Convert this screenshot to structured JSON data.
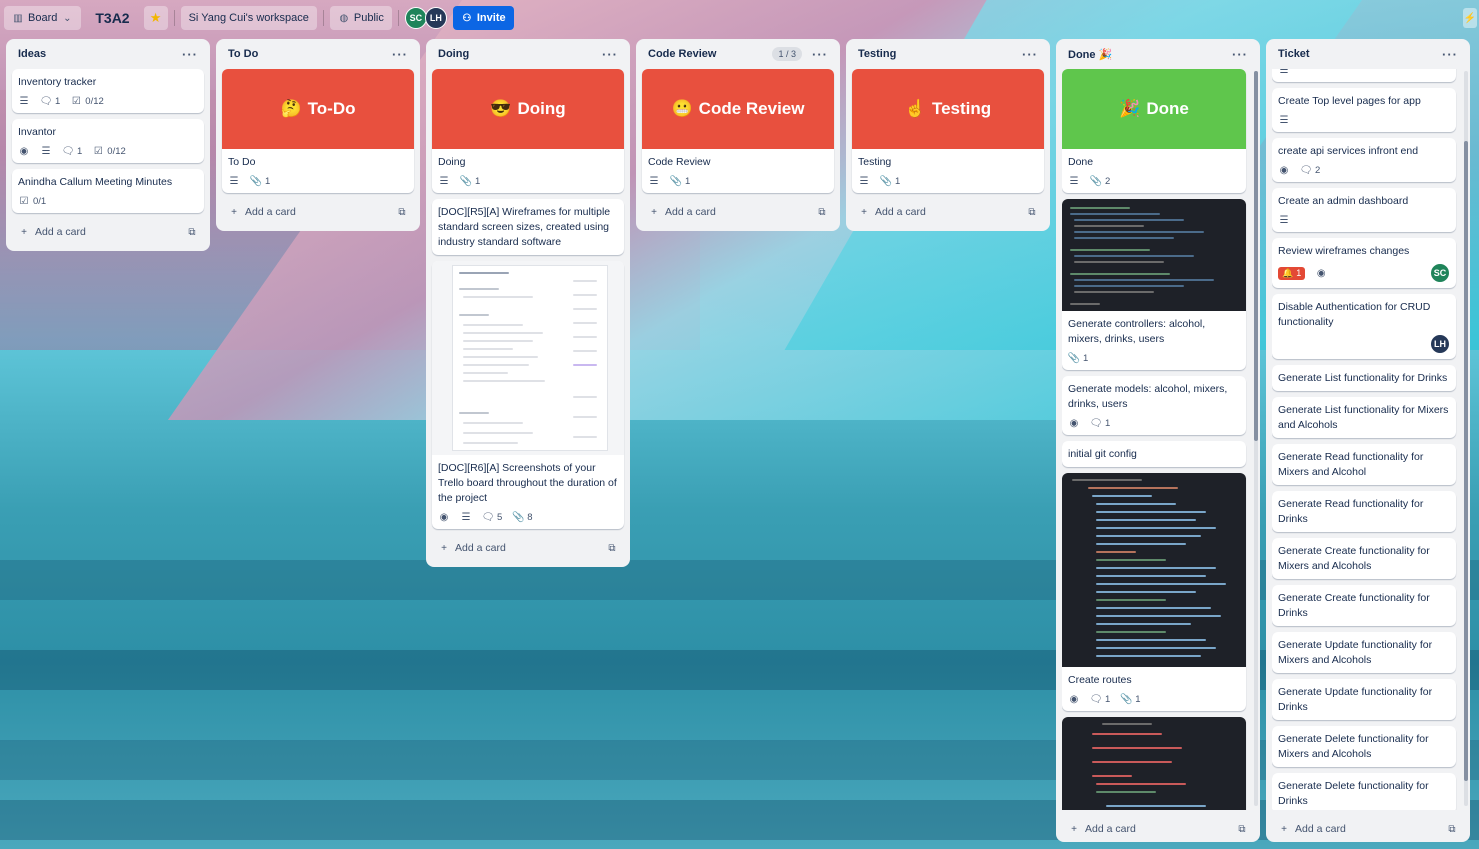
{
  "topbar": {
    "view_label": "Board",
    "board_title": "T3A2",
    "workspace_label": "Si Yang Cui's workspace",
    "visibility_label": "Public",
    "members": [
      {
        "initials": "SC",
        "color": "#1f845a"
      },
      {
        "initials": "LH",
        "color": "#253858"
      }
    ],
    "invite_label": "Invite"
  },
  "add_card_label": "Add a card",
  "lists": {
    "ideas": {
      "title": "Ideas",
      "cards": [
        {
          "title": "Inventory tracker",
          "comments": "1",
          "checklist": "0/12"
        },
        {
          "title": "Invantor",
          "comments": "1",
          "checklist": "0/12"
        },
        {
          "title": "Anindha Callum Meeting Minutes",
          "checklist": "0/1"
        }
      ]
    },
    "todo": {
      "title": "To Do",
      "cover_emoji": "🤔",
      "cover_text": "To-Do",
      "cover_color": "#e8503e",
      "cards": [
        {
          "title": "To Do",
          "attachments": "1"
        }
      ]
    },
    "doing": {
      "title": "Doing",
      "cover_emoji": "😎",
      "cover_text": "Doing",
      "cover_color": "#e8503e",
      "cards": [
        {
          "title": "Doing",
          "attachments": "1"
        },
        {
          "title": "[DOC][R5][A] Wireframes for multiple standard screen sizes, created using industry standard software"
        },
        {
          "title": "[DOC][R6][A] Screenshots of your Trello board throughout the duration of the project",
          "comments": "5",
          "attachments": "8"
        }
      ]
    },
    "review": {
      "title": "Code Review",
      "count": "1 / 3",
      "cover_emoji": "😬",
      "cover_text": "Code Review",
      "cover_color": "#e8503e",
      "cards": [
        {
          "title": "Code Review",
          "attachments": "1"
        }
      ]
    },
    "testing": {
      "title": "Testing",
      "cover_emoji": "☝",
      "cover_text": "Testing",
      "cover_color": "#e8503e",
      "cards": [
        {
          "title": "Testing",
          "attachments": "1"
        }
      ]
    },
    "done": {
      "title": "Done 🎉",
      "cover_emoji": "🎉",
      "cover_text": "Done",
      "cover_color": "#5fc64c",
      "cards": [
        {
          "title": "Done",
          "attachments": "2"
        },
        {
          "title": "Generate controllers: alcohol, mixers, drinks, users",
          "attachments": "1"
        },
        {
          "title": "Generate models: alcohol, mixers, drinks, users",
          "comments": "1"
        },
        {
          "title": "initial git config"
        },
        {
          "title": "Create routes",
          "comments": "1",
          "attachments": "1"
        }
      ]
    },
    "ticket": {
      "title": "Ticket",
      "cards": [
        {
          "title": "Create Top level pages for app"
        },
        {
          "title": "create api services infront end",
          "comments": "2"
        },
        {
          "title": "Create an admin dashboard"
        },
        {
          "title": "Review wireframes changes",
          "notifications": "1",
          "member": "SC"
        },
        {
          "title": "Disable Authentication for CRUD functionality",
          "member": "LH"
        },
        {
          "title": "Generate List functionality for Drinks"
        },
        {
          "title": "Generate List functionality for Mixers and Alcohols"
        },
        {
          "title": "Generate Read functionality for Mixers and Alcohol"
        },
        {
          "title": "Generate Read functionality for Drinks"
        },
        {
          "title": "Generate Create functionality for Mixers and Alcohols"
        },
        {
          "title": "Generate Create functionality for Drinks"
        },
        {
          "title": "Generate Update functionality for Mixers and Alcohols"
        },
        {
          "title": "Generate Update functionality for Drinks"
        },
        {
          "title": "Generate Delete functionality for Mixers and Alcohols"
        },
        {
          "title": "Generate Delete functionality for Drinks"
        }
      ]
    }
  }
}
